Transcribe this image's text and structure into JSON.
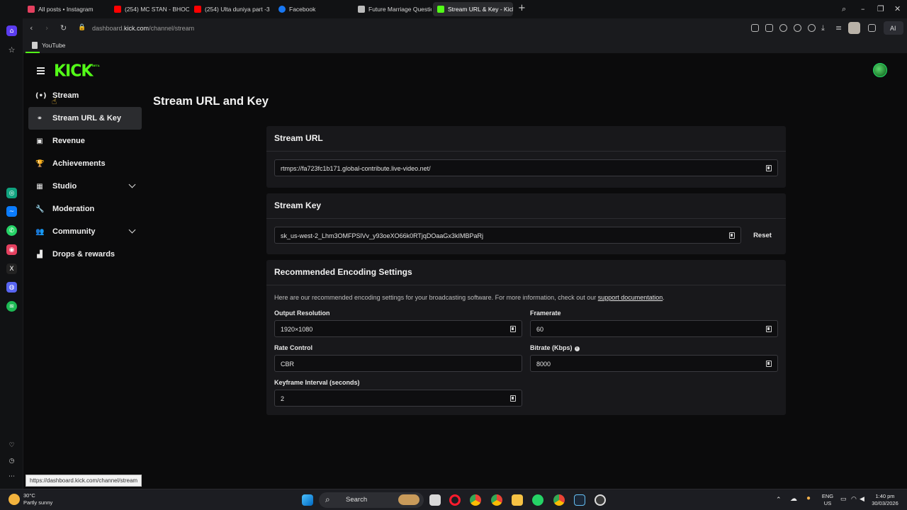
{
  "browser": {
    "tabs": [
      {
        "title": "All posts • Instagram",
        "color": "#e4405f"
      },
      {
        "title": "(254) MC STAN - BHOOL",
        "color": "#ff0000"
      },
      {
        "title": "(254) Ulta duniya part -3",
        "color": "#ff0000"
      },
      {
        "title": "Facebook",
        "color": "#1877f2"
      },
      {
        "title": "Future Marriage Question",
        "color": "#bbbbbb"
      },
      {
        "title": "Stream URL & Key - Kick",
        "color": "#53fc18"
      }
    ],
    "new_tab": "+",
    "address": {
      "prefix": "dashboard.",
      "domain": "kick.com",
      "path": "/channel/stream"
    },
    "ai_label": "AI",
    "bookmarks": [
      {
        "label": "YouTube"
      }
    ],
    "status_url": "https://dashboard.kick.com/channel/stream"
  },
  "app": {
    "logo": "KICK",
    "beta": "BETA",
    "page_title": "Stream URL and Key"
  },
  "sidebar": {
    "items": [
      {
        "label": "Stream",
        "icon": "broadcast-icon",
        "glyph": "(•)"
      },
      {
        "label": "Stream URL & Key",
        "icon": "link-icon",
        "glyph": "⚭"
      },
      {
        "label": "Revenue",
        "icon": "money-icon",
        "glyph": "▣"
      },
      {
        "label": "Achievements",
        "icon": "trophy-icon",
        "glyph": "🏆"
      },
      {
        "label": "Studio",
        "icon": "studio-icon",
        "glyph": "▦"
      },
      {
        "label": "Moderation",
        "icon": "wrench-icon",
        "glyph": "🔧"
      },
      {
        "label": "Community",
        "icon": "people-icon",
        "glyph": "👥"
      },
      {
        "label": "Drops & rewards",
        "icon": "chart-icon",
        "glyph": "▟"
      }
    ]
  },
  "stream_url": {
    "heading": "Stream URL",
    "value": "rtmps://fa723fc1b171.global-contribute.live-video.net/"
  },
  "stream_key": {
    "heading": "Stream Key",
    "value": "sk_us-west-2_Lhm3OMFPSlVv_y93oeXO66k0RTjqDOaaGx3kIMBPaRj",
    "reset": "Reset"
  },
  "encoding": {
    "heading": "Recommended Encoding Settings",
    "description": "Here are our recommended encoding settings for your broadcasting software. For more information, check out our ",
    "link": "support documentation",
    "period": ".",
    "output_resolution": {
      "label": "Output Resolution",
      "value": "1920×1080"
    },
    "framerate": {
      "label": "Framerate",
      "value": "60"
    },
    "rate_control": {
      "label": "Rate Control",
      "value": "CBR"
    },
    "bitrate": {
      "label": "Bitrate (Kbps)",
      "value": "8000"
    },
    "keyframe": {
      "label": "Keyframe Interval (seconds)",
      "value": "2"
    }
  },
  "taskbar": {
    "weather_temp": "30°C",
    "weather_desc": "Partly sunny",
    "search": "Search",
    "lang": "ENG",
    "region": "US",
    "time": "1:40 pm",
    "date": "30/03/2026"
  }
}
